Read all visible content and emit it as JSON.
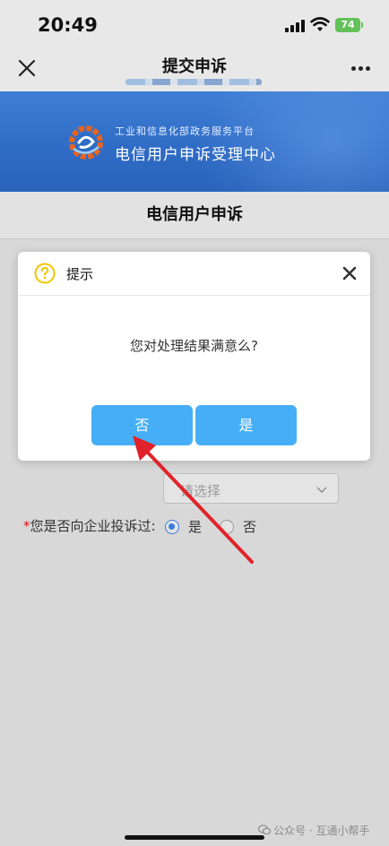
{
  "status_bar": {
    "time": "20:49",
    "battery": "74"
  },
  "nav": {
    "title": "提交申诉"
  },
  "banner": {
    "subtitle": "工业和信息化部政务服务平台",
    "title": "电信用户申诉受理中心"
  },
  "page": {
    "title": "电信用户申诉"
  },
  "form": {
    "select_placeholder": "请选择",
    "complaint_label": "您是否向企业投诉过:",
    "required_mark": "*",
    "option_yes": "是",
    "option_no": "否",
    "selected": "是"
  },
  "dialog": {
    "title": "提示",
    "message": "您对处理结果满意么?",
    "btn_no": "否",
    "btn_yes": "是"
  },
  "watermark": {
    "text": "公众号 · 互通小帮手"
  },
  "colors": {
    "button": "#46aef7",
    "banner": "#2f6cc6",
    "arrow": "#e0232a",
    "radio_checked": "#3b7be0",
    "help_icon": "#f2c500"
  },
  "icons": [
    "close-icon",
    "more-icon",
    "help-icon",
    "dialog-close-icon",
    "chevron-down-icon",
    "wechat-icon"
  ]
}
